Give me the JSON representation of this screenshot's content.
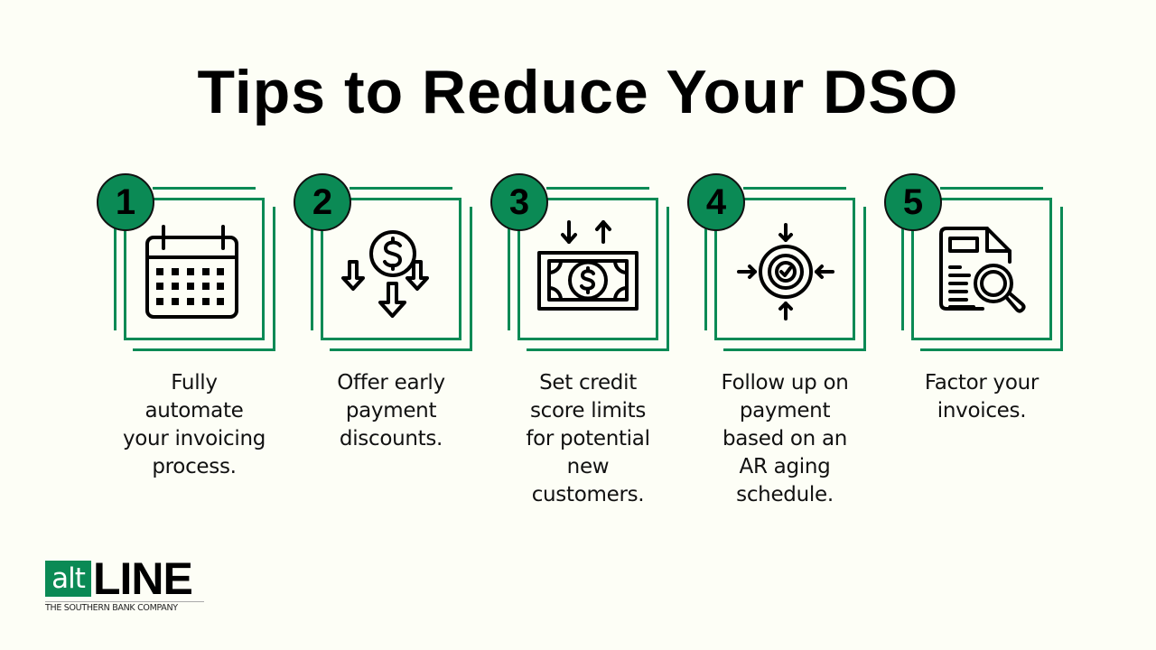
{
  "title": "Tips to Reduce Your DSO",
  "colors": {
    "accent_green": "#0b8a55",
    "background": "#fdfef6",
    "text": "#000000"
  },
  "tips": [
    {
      "number": "1",
      "icon": "calendar-icon",
      "lines": [
        "Fully",
        "automate",
        "your invoicing",
        "process."
      ]
    },
    {
      "number": "2",
      "icon": "dollar-discount-arrows-icon",
      "lines": [
        "Offer early",
        "payment",
        "discounts."
      ]
    },
    {
      "number": "3",
      "icon": "banknote-arrows-icon",
      "lines": [
        "Set credit",
        "score limits",
        "for potential",
        "new",
        "customers."
      ]
    },
    {
      "number": "4",
      "icon": "target-check-icon",
      "lines": [
        "Follow up on",
        "payment",
        "based on an",
        "AR aging",
        "schedule."
      ]
    },
    {
      "number": "5",
      "icon": "document-search-icon",
      "lines": [
        "Factor your",
        "invoices."
      ]
    }
  ],
  "logo": {
    "alt": "alt",
    "line": "LINE",
    "tagline": "THE SOUTHERN BANK COMPANY"
  }
}
